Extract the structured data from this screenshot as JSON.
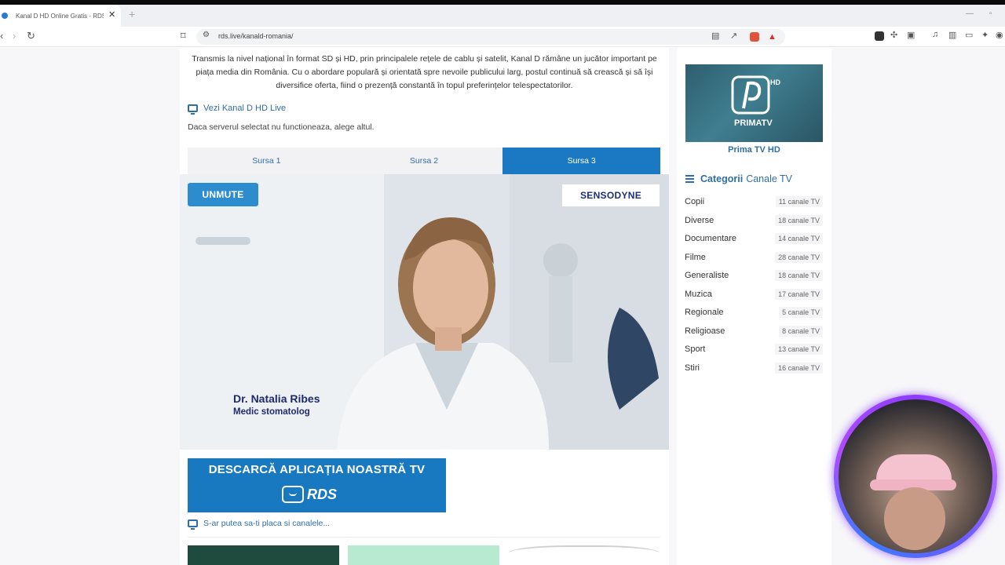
{
  "browser": {
    "tab_title": "Kanal D HD Online Gratis - RDS",
    "tab_close": "✕",
    "new_tab": "+",
    "url": "rds.live/kanald-romania/"
  },
  "content": {
    "intro": "Transmis la nivel național în format SD și HD, prin principalele rețele de cablu și satelit, Kanal D rămâne un jucător important pe piața media din România. Cu o abordare populară și orientată spre nevoile publicului larg, postul continuă să crească și să își diversifice oferta, fiind o prezență constantă în topul preferințelor telespectatorilor.",
    "live_link": "Vezi Kanal D HD Live",
    "server_note": "Daca serverul selectat nu functioneaza, alege altul.",
    "sources": [
      "Sursa 1",
      "Sursa 2",
      "Sursa 3"
    ],
    "player": {
      "unmute": "UNMUTE",
      "ad_brand": "SENSODYNE",
      "person_name": "Dr. Natalia Ribes",
      "person_role": "Medic stomatolog"
    },
    "banner": {
      "text": "DESCARCĂ APLICAȚIA NOASTRĂ TV",
      "logo": "RDS"
    },
    "related": "S-ar putea sa-ti placa si canalele..."
  },
  "sidebar": {
    "featured_caption": "Prima TV HD",
    "featured_logo_text": "PRIMATV",
    "featured_logo_hd": "HD",
    "categories_title_bold": "Categorii",
    "categories_title_rest": "Canale TV",
    "categories": [
      {
        "name": "Copii",
        "count": "11 canale TV"
      },
      {
        "name": "Diverse",
        "count": "18 canale TV"
      },
      {
        "name": "Documentare",
        "count": "14 canale TV"
      },
      {
        "name": "Filme",
        "count": "28 canale TV"
      },
      {
        "name": "Generaliste",
        "count": "18 canale TV"
      },
      {
        "name": "Muzica",
        "count": "17 canale TV"
      },
      {
        "name": "Regionale",
        "count": "5 canale TV"
      },
      {
        "name": "Religioase",
        "count": "8 canale TV"
      },
      {
        "name": "Sport",
        "count": "13 canale TV"
      },
      {
        "name": "Stiri",
        "count": "16 canale TV"
      }
    ]
  },
  "colors": {
    "accent": "#1b79c3",
    "link": "#2f6ea8"
  }
}
